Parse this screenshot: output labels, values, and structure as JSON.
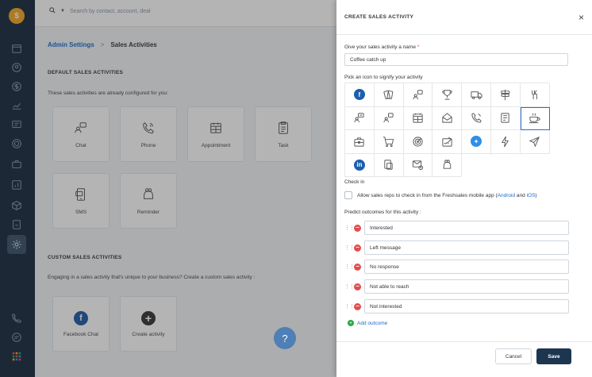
{
  "nav": {
    "logo_glyph": "$",
    "items": [
      {
        "icon": "calendar-icon"
      },
      {
        "icon": "contact-icon"
      },
      {
        "icon": "dollar-icon"
      },
      {
        "icon": "reports-icon"
      },
      {
        "icon": "chat-icon"
      },
      {
        "icon": "target-icon"
      },
      {
        "icon": "briefcase-icon"
      },
      {
        "icon": "chart-icon"
      },
      {
        "icon": "box-icon"
      },
      {
        "icon": "document-icon"
      },
      {
        "icon": "settings-icon"
      }
    ],
    "bottom": [
      {
        "icon": "phone-icon"
      },
      {
        "icon": "message-icon"
      },
      {
        "icon": "apps-grid-icon"
      }
    ]
  },
  "topbar": {
    "search_placeholder": "Search by contact, account, deal"
  },
  "breadcrumb": {
    "parent": "Admin Settings",
    "separator": ">",
    "current": "Sales Activities"
  },
  "default_section": {
    "title": "DEFAULT SALES ACTIVITIES",
    "description": "These sales activities are already configured for you:",
    "tiles": [
      {
        "label": "Chat"
      },
      {
        "label": "Phone"
      },
      {
        "label": "Appointment"
      },
      {
        "label": "Task"
      },
      {
        "label": "SMS"
      },
      {
        "label": "Reminder"
      }
    ]
  },
  "custom_section": {
    "title": "CUSTOM SALES ACTIVITIES",
    "description": "Engaging in a sales activity that's unique to your business? Create a custom sales activity :",
    "tiles": [
      {
        "label": "Facebook Chat"
      },
      {
        "label": "Create activity"
      }
    ]
  },
  "help": {
    "glyph": "?"
  },
  "panel": {
    "title": "CREATE SALES ACTIVITY",
    "close": "×",
    "name_label": "Give your sales activity a name",
    "required_mark": "*",
    "name_value": "Coffee catch up",
    "icon_label": "Pick an icon to signify your activity",
    "icons": [
      "facebook-icon",
      "cards-icon",
      "chat-icon",
      "trophy-icon",
      "truck-icon",
      "signpost-icon",
      "fork-knife-icon",
      "chat-users-icon",
      "chat-icon",
      "calendar-icon",
      "envelope-open-icon",
      "phone-icon",
      "notes-icon",
      "coffee-cup-icon",
      "briefcase-icon",
      "cart-icon",
      "target-icon",
      "sign-document-icon",
      "twitter-icon",
      "lightning-icon",
      "paper-plane-icon",
      "linkedin-icon",
      "documents-icon",
      "email-time-icon",
      "reminder-icon"
    ],
    "selected_icon": "coffee-cup-icon",
    "checkin_label": "Check in",
    "checkin_text_before": "Allow sales reps to check in from the Freshsales mobile app (",
    "checkin_android": "Android",
    "checkin_and": "and",
    "checkin_ios": "iOS",
    "checkin_text_after": ")",
    "outcomes_label": "Predict outcomes for this activity :",
    "outcomes": [
      {
        "value": "Interested"
      },
      {
        "value": "Left message"
      },
      {
        "value": "No response"
      },
      {
        "value": "Not able to reach"
      },
      {
        "value": "Not interested"
      }
    ],
    "add_outcome": "Add outcome",
    "cancel": "Cancel",
    "save": "Save"
  }
}
